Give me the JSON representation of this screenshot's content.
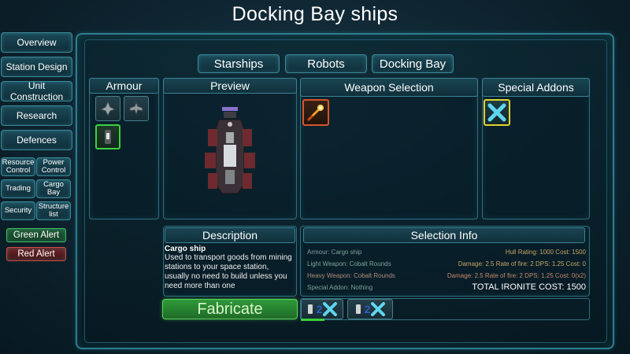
{
  "title": "Docking Bay ships",
  "sidebar": {
    "items": [
      "Overview",
      "Station Design",
      "Unit Construction",
      "Research",
      "Defences"
    ],
    "small": [
      "Resource Control",
      "Power Control",
      "Trading",
      "Cargo Bay",
      "Security",
      "Structure list"
    ],
    "alerts": [
      {
        "label": "Green Alert",
        "color": "#2fa84a"
      },
      {
        "label": "Red Alert",
        "color": "#c23a3a"
      }
    ]
  },
  "tabs": [
    "Starships",
    "Robots",
    "Docking Bay"
  ],
  "panels": {
    "armour": "Armour",
    "preview": "Preview",
    "weapon": "Weapon Selection",
    "special": "Special Addons",
    "description": "Description",
    "selection_info": "Selection Info"
  },
  "description": {
    "name": "Cargo ship",
    "text": "Used to transport goods from mining stations to your space station, usually no need to build unless you need more than one"
  },
  "selection": {
    "armour": {
      "label": "Armour: Cargo ship",
      "stats": "Hull Rating: 1000  Cost: 1500"
    },
    "light": {
      "label": "Light Weapon: Cobalt Rounds",
      "stats": "Damage: 2.5  Rate of fire: 2  DPS: 1.25  Cost: 0"
    },
    "heavy": {
      "label": "Heavy Weapon: Cobalt Rounds",
      "stats": "Damage: 2.5  Rate of fire: 2  DPS: 1.25  Cost: 0(x2)"
    },
    "special": {
      "label": "Special Addon: Nothing"
    },
    "total": "TOTAL IRONITE COST: 1500"
  },
  "fabricate": "Fabricate",
  "queue": [
    {
      "count": "2",
      "icon": "cargo-ship-icon"
    },
    {
      "count": "2",
      "icon": "cargo-ship-icon"
    }
  ],
  "colors": {
    "accent": "#2f7d8e",
    "fabricate": "#2f9a3a",
    "special_border": "#e0d232",
    "weapon_border": "#d4552a"
  }
}
